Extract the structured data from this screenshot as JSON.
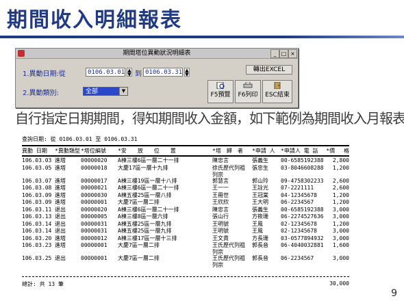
{
  "slide": {
    "title": "期間收入明細報表",
    "page_number": "9"
  },
  "window": {
    "title": "期間塔位異動狀況明細表",
    "controls": {
      "minimize": "_",
      "maximize": "□",
      "close": "×"
    },
    "date_label": "1.異動日期:從",
    "date_from": "0106.03.01",
    "date_to_label": "到",
    "date_to": "0106.03.31",
    "type_label": "2.異動類別:",
    "type_value": "全部",
    "buttons": {
      "export_excel": "轉出EXCEL",
      "preview": "F5預覽",
      "print": "F6列印",
      "exit": "ESC結束"
    }
  },
  "caption": "自行指定日期期間，得知期間收入金額，如下範例為期間收入月報表",
  "report": {
    "query_line": "查詢日期: 從 0106.03.01 至 0106.03.31",
    "headers": [
      "異動 日期",
      "*異動類型",
      "*塔位編號",
      "*安　　放　　位　　置",
      "*塔　歸　者",
      "*申請 人",
      "*申請人 電 話",
      "*價　 格"
    ],
    "rows": [
      {
        "date": "106.03.03",
        "type": "進塔",
        "slot": "00000020",
        "location": "A棟三樓6區一層二十一排",
        "family": "陳忠言",
        "family2": "",
        "applicant": "張義生",
        "phone": "00-6585192388",
        "amount": "2,800"
      },
      {
        "date": "106.03.05",
        "type": "進塔",
        "slot": "00000018",
        "location": "大慶17區一層十九排",
        "family": "徐氏歷代列祖",
        "family2": "列宗",
        "applicant": "張忠生",
        "phone": "03-8046608288",
        "amount": "1,200"
      },
      {
        "date": "106.03.07",
        "type": "進塔",
        "slot": "00000017",
        "location": "A棟三樓19區一層十八排",
        "family": "郭慧言",
        "family2": "",
        "applicant": "郭山玲",
        "phone": "09-4758302233",
        "amount": "2,600"
      },
      {
        "date": "106.03.08",
        "type": "進塔",
        "slot": "00000021",
        "location": "A棟三樓6區一層二十一排",
        "family": "王一一",
        "family2": "",
        "applicant": "王詮光",
        "phone": "07-2221111",
        "amount": "2,600"
      },
      {
        "date": "106.03.09",
        "type": "進塔",
        "slot": "00000030",
        "location": "A棟五樓25區一層八排",
        "family": "王冊世",
        "family2": "",
        "applicant": "王冠棠",
        "phone": "04-12345678",
        "amount": "1,200"
      },
      {
        "date": "106.03.09",
        "type": "進塔",
        "slot": "00000001",
        "location": "大慶7區一層二排",
        "family": "王欣欣",
        "family2": "",
        "applicant": "王大明",
        "phone": "06-2234567",
        "amount": "1,200"
      },
      {
        "date": "106.03.11",
        "type": "退出",
        "slot": "00000020",
        "location": "A棟三樓6區一層二十一排",
        "family": "陳忠言",
        "family2": "",
        "applicant": "張義生",
        "phone": "00-6585192388",
        "amount": "3,000"
      },
      {
        "date": "106.03.13",
        "type": "退出",
        "slot": "00000005",
        "location": "A棟三樓8區一層六排",
        "family": "張山行",
        "family2": "",
        "applicant": "方筱珊",
        "phone": "06-2274527636",
        "amount": "3,000"
      },
      {
        "date": "106.03.14",
        "type": "退出",
        "slot": "00000031",
        "location": "A棟五樓25區一層九排",
        "family": "王明號",
        "family2": "",
        "applicant": "王風",
        "phone": "02-12345678",
        "amount": "1,200"
      },
      {
        "date": "106.03.14",
        "type": "退出",
        "slot": "00000031",
        "location": "A棟五樓25區一層九排",
        "family": "王明號",
        "family2": "",
        "applicant": "王風",
        "phone": "02-12345678",
        "amount": "3,000"
      },
      {
        "date": "106.03.20",
        "type": "進塔",
        "slot": "00000012",
        "location": "A棟三樓17區一層十三排",
        "family": "王文貴",
        "family2": "",
        "applicant": "方長珊",
        "phone": "03-0577894932",
        "amount": "3,000"
      },
      {
        "date": "106.03.23",
        "type": "進塔",
        "slot": "00000001",
        "location": "大慶7區一層二排",
        "family": "王氏歷代列祖",
        "family2": "列宗",
        "applicant": "郭長音",
        "phone": "06-4040032881",
        "amount": "1,600"
      },
      {
        "date": "106.03.25",
        "type": "退出",
        "slot": "00000001",
        "location": "大慶7區一層二排",
        "family": "王氏歷代列祖",
        "family2": "列宗",
        "applicant": "郭長音",
        "phone": "06-2234567",
        "amount": "3,000"
      }
    ],
    "total_label": "總計: 共 13 筆",
    "total_amount": "30,000"
  }
}
